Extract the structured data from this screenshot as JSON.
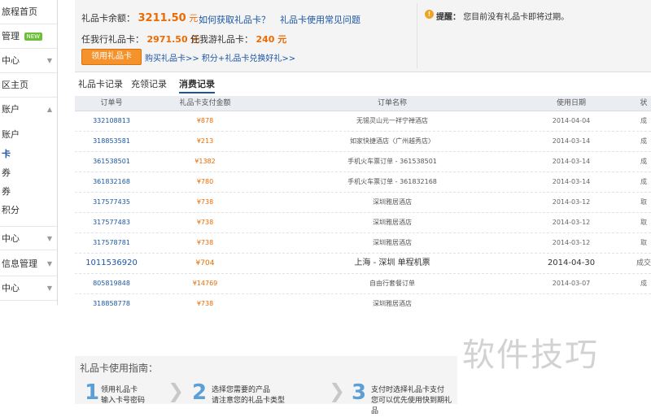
{
  "sidebar": {
    "items": [
      {
        "label": "旅程首页"
      },
      {
        "label": "管理",
        "badge": "NEW"
      },
      {
        "label": "中心"
      },
      {
        "label": "区主页"
      },
      {
        "label": "账户"
      }
    ],
    "subitems": [
      {
        "label": "账户"
      },
      {
        "label": "卡"
      },
      {
        "label": "券"
      },
      {
        "label": "券"
      },
      {
        "label": "积分"
      }
    ],
    "items_lower": [
      {
        "label": "中心"
      },
      {
        "label": "信息管理"
      },
      {
        "label": "中心"
      }
    ]
  },
  "info": {
    "balance_label": "礼品卡余额：",
    "balance_value": "3211.50",
    "balance_unit": "元",
    "link_howto": "如何获取礼品卡？",
    "link_faq": "礼品卡使用常见问题",
    "travel_label": "任我行礼品卡：",
    "travel_value": "2971.50 元",
    "tour_label": "任我游礼品卡：",
    "tour_value": "240 元",
    "use_button": "领用礼品卡",
    "buy_links": "购买礼品卡>> 积分+礼品卡兑换好礼>>",
    "warn_title": "提醒：",
    "warn_text": "您目前没有礼品卡即将过期。"
  },
  "tabs": [
    {
      "label": "礼品卡记录"
    },
    {
      "label": "充领记录"
    },
    {
      "label": "消费记录"
    }
  ],
  "table": {
    "headers": [
      "订单号",
      "礼品卡支付金额",
      "订单名称",
      "使用日期",
      "状"
    ],
    "rows": [
      {
        "id": "332108813",
        "amount": "¥878",
        "name": "无锡灵山元一祥宁禅酒店",
        "date": "2014-04-04",
        "status": "成"
      },
      {
        "id": "318853581",
        "amount": "¥213",
        "name": "如家快捷酒店〈广州越秀店〉",
        "date": "2014-03-14",
        "status": "成"
      },
      {
        "id": "361538501",
        "amount": "¥1382",
        "name": "手机火车票订单 - 361538501",
        "date": "2014-03-14",
        "status": "成"
      },
      {
        "id": "361832168",
        "amount": "¥780",
        "name": "手机火车票订单 - 361832168",
        "date": "2014-03-14",
        "status": "成"
      },
      {
        "id": "317577435",
        "amount": "¥738",
        "name": "深圳雅居酒店",
        "date": "2014-03-12",
        "status": "取"
      },
      {
        "id": "317577483",
        "amount": "¥738",
        "name": "深圳雅居酒店",
        "date": "2014-03-12",
        "status": "取"
      },
      {
        "id": "317578781",
        "amount": "¥738",
        "name": "深圳雅居酒店",
        "date": "2014-03-12",
        "status": "取"
      },
      {
        "id": "1011536920",
        "amount": "¥704",
        "name": "上海 - 深圳 单程机票",
        "date": "2014-04-30",
        "status": "成交"
      },
      {
        "id": "805819848",
        "amount": "¥14769",
        "name": "自由行套餐订单",
        "date": "2014-03-07",
        "status": "成"
      },
      {
        "id": "318858778",
        "amount": "¥738",
        "name": "深圳雅居酒店",
        "date": "",
        "status": ""
      }
    ]
  },
  "guide": {
    "title": "礼品卡使用指南：",
    "steps": [
      {
        "num": "1",
        "line1": "领用礼品卡",
        "line2": "输入卡号密码"
      },
      {
        "num": "2",
        "line1": "选择您需要的产品",
        "line2": "请注意您的礼品卡类型"
      },
      {
        "num": "3",
        "line1": "支付时选择礼品卡支付",
        "line2": "您可以优先使用快到期礼品"
      }
    ]
  },
  "watermark": "软件技巧",
  "colors": {
    "accent_orange": "#ec6a00",
    "link_blue": "#1a56a5",
    "button_orange": "#f5922b"
  }
}
